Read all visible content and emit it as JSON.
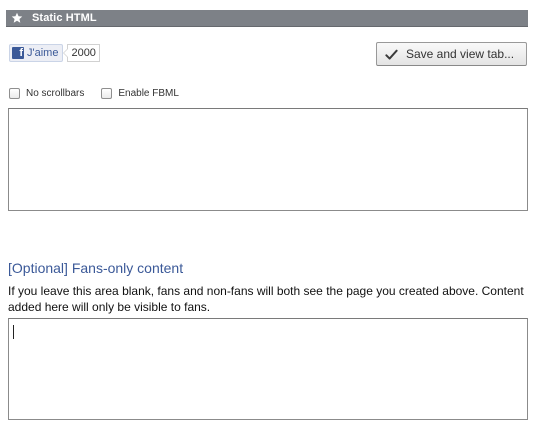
{
  "panel": {
    "title": "Static HTML",
    "title_icon": "star-icon"
  },
  "like": {
    "label": "J'aime",
    "count": "2000",
    "logo_letter": "f",
    "brand_color": "#3b5998"
  },
  "toolbar": {
    "save_label": "Save and view tab...",
    "save_icon": "checkmark-icon"
  },
  "options": {
    "no_scrollbars_label": "No scrollbars",
    "no_scrollbars_checked": false,
    "enable_fbml_label": "Enable FBML",
    "enable_fbml_checked": false
  },
  "editor": {
    "html_value": ""
  },
  "fans_section": {
    "heading": "[Optional] Fans-only content",
    "description": "If you leave this area blank, fans and non-fans will both see the page you created above. Content added here will only be visible to fans.",
    "value": ""
  }
}
